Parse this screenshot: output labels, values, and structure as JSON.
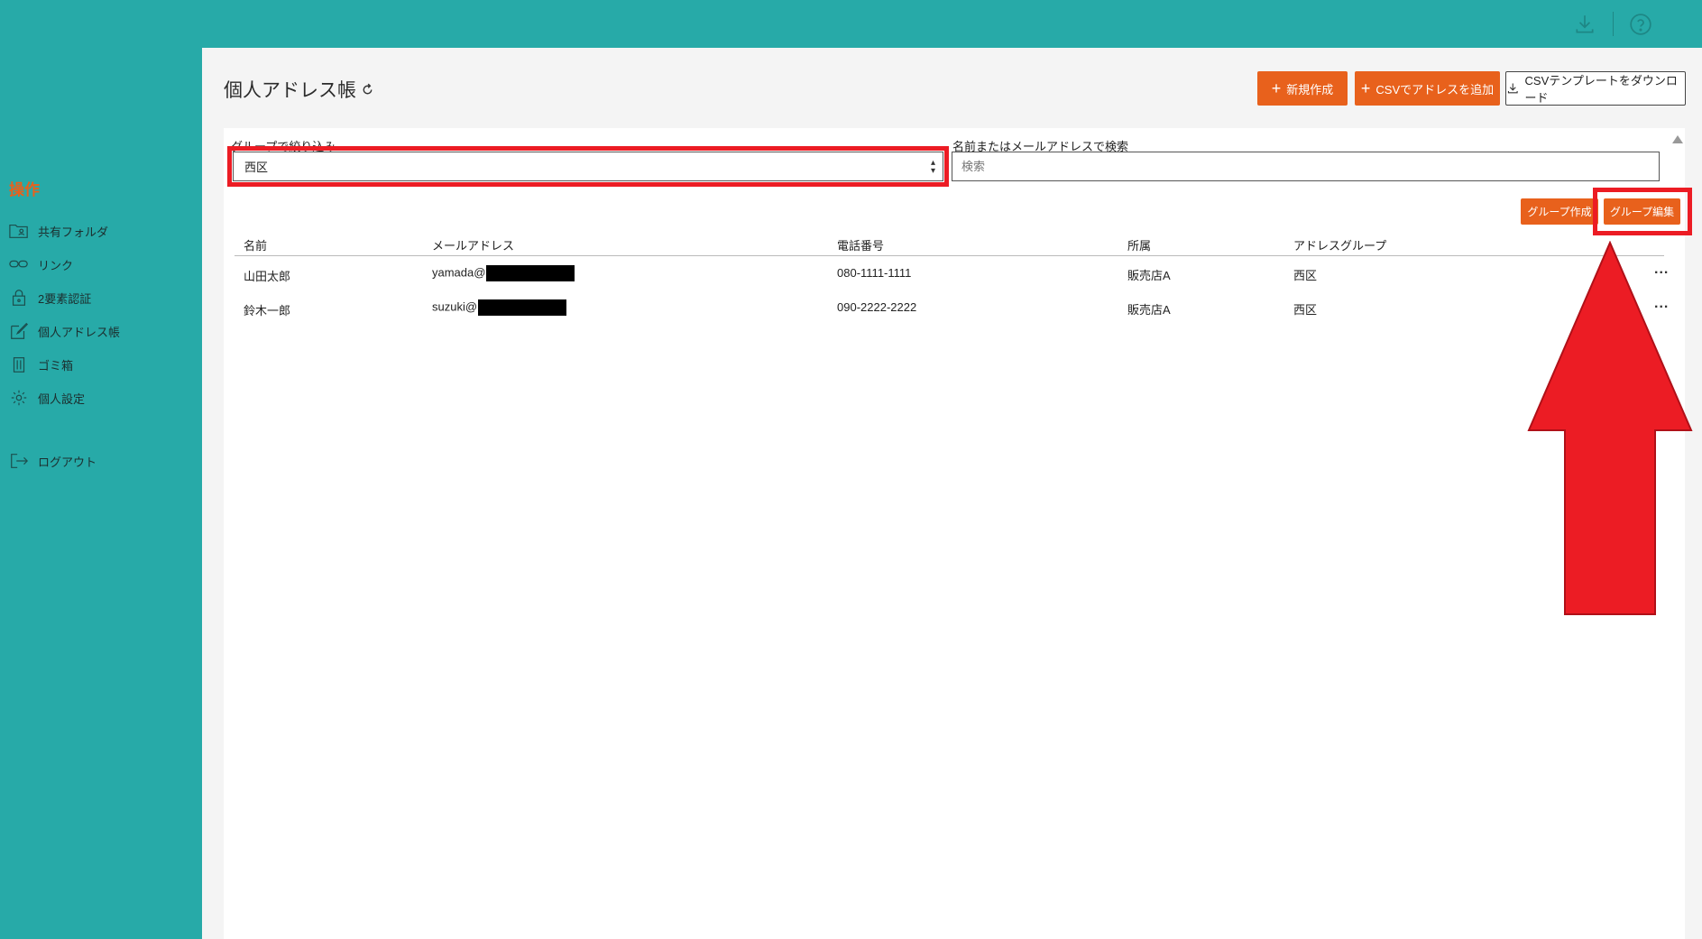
{
  "topbar": {
    "download_icon": "download-icon",
    "help_icon": "help-circle-icon"
  },
  "sidebar": {
    "heading": "操作",
    "items": [
      {
        "label": "共有フォルダ",
        "icon": "shared-folder-icon"
      },
      {
        "label": "リンク",
        "icon": "link-icon"
      },
      {
        "label": "2要素認証",
        "icon": "lock-icon"
      },
      {
        "label": "個人アドレス帳",
        "icon": "edit-icon"
      },
      {
        "label": "ゴミ箱",
        "icon": "trash-icon"
      },
      {
        "label": "個人設定",
        "icon": "gear-icon"
      },
      {
        "label": "ログアウト",
        "icon": "logout-icon"
      }
    ]
  },
  "page": {
    "title": "個人アドレス帳"
  },
  "actions": {
    "new": "新規作成",
    "csv_add": "CSVでアドレスを追加",
    "csv_template": "CSVテンプレートをダウンロード"
  },
  "filter": {
    "group_label": "グループで絞り込み",
    "group_value": "西区",
    "search_label": "名前またはメールアドレスで検索",
    "search_placeholder": "検索"
  },
  "group_actions": {
    "create": "グループ作成",
    "edit": "グループ編集"
  },
  "table": {
    "headers": [
      "名前",
      "メールアドレス",
      "電話番号",
      "所属",
      "アドレスグループ"
    ],
    "rows": [
      {
        "name": "山田太郎",
        "email_prefix": "yamada@",
        "tel": "080-1111-1111",
        "org": "販売店A",
        "group": "西区",
        "menu": "..."
      },
      {
        "name": "鈴木一郎",
        "email_prefix": "suzuki@",
        "tel": "090-2222-2222",
        "org": "販売店A",
        "group": "西区",
        "menu": "..."
      }
    ]
  },
  "colors": {
    "teal": "#27aaa8",
    "orange": "#e8611c",
    "highlight_red": "#ec1c24"
  }
}
